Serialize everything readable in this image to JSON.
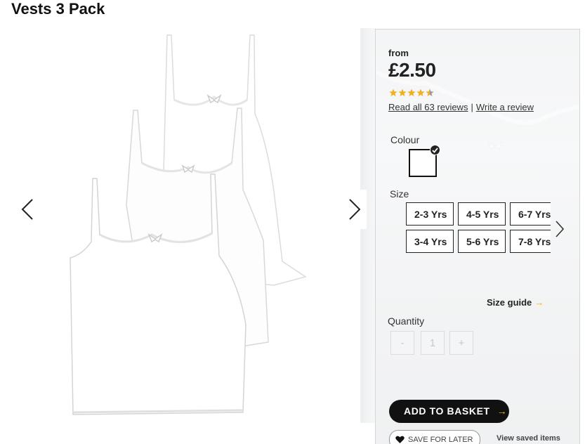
{
  "product": {
    "title": "Vests 3 Pack"
  },
  "pricing": {
    "prefix": "from",
    "price": "£2.50",
    "rating": 4.5,
    "rating_max": 5
  },
  "reviews": {
    "read_all": "Read all 63 reviews",
    "separator": "|",
    "write": "Write a review"
  },
  "colour": {
    "label": "Colour",
    "selected": "white"
  },
  "size": {
    "label": "Size",
    "options": [
      "2-3 Yrs",
      "4-5 Yrs",
      "6-7 Yrs",
      "3-4 Yrs",
      "5-6 Yrs",
      "7-8 Yrs"
    ],
    "guide_label": "Size guide",
    "guide_arrow": "→"
  },
  "quantity": {
    "label": "Quantity",
    "minus": "-",
    "value": "1",
    "plus": "+"
  },
  "actions": {
    "add_to_basket": "ADD TO BASKET",
    "basket_arrow": "→",
    "save_for_later": "SAVE FOR LATER",
    "view_saved": "View saved items"
  },
  "colors": {
    "star": "#f2b01e",
    "star_empty": "#999999",
    "button_bg": "#111111",
    "accent_arrow": "#f2c200"
  },
  "icons": {
    "prev": "chevron-left-icon",
    "next": "chevron-right-icon",
    "heart": "heart-icon",
    "check": "check-icon"
  }
}
